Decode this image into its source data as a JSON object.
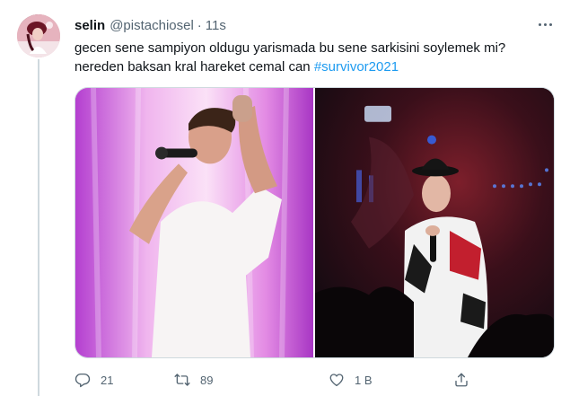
{
  "tweet": {
    "author_name": "selin",
    "author_handle": "@pistachiosel",
    "separator": "·",
    "time": "11s",
    "text_line1": "gecen sene sampiyon oldugu yarismada bu sene sarkisini soylemek mi?",
    "text_line2_prefix": "nereden baksan kral hareket cemal can",
    "hashtag": "#survivor2021"
  },
  "actions": {
    "reply_count": "21",
    "retweet_count": "89",
    "like_count": "1 B"
  },
  "icons": {
    "more": "more-horizontal-icon",
    "reply": "reply-icon",
    "retweet": "retweet-icon",
    "like": "heart-icon",
    "share": "share-icon"
  },
  "colors": {
    "accent": "#1d9bf0",
    "secondary_text": "#536471",
    "primary_text": "#0f1419",
    "border": "#cfd9de"
  }
}
